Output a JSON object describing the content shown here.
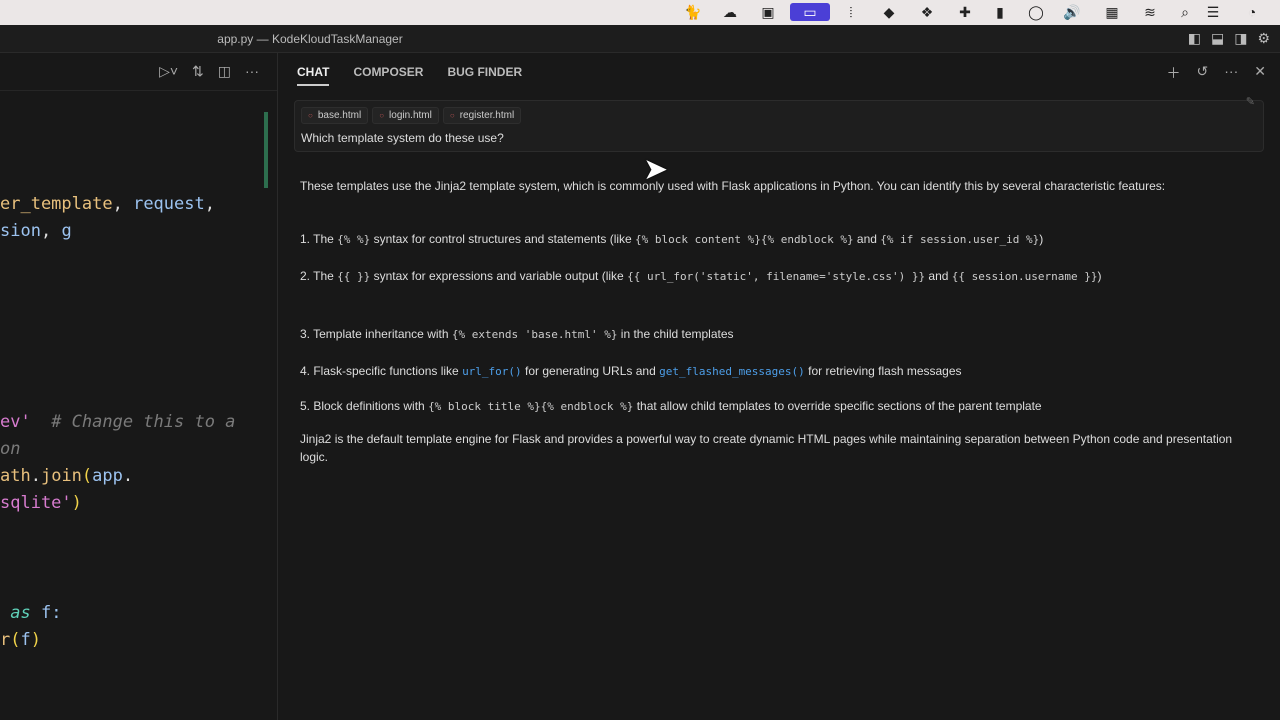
{
  "window": {
    "title": "app.py — KodeKloudTaskManager"
  },
  "menubar": {
    "icons": [
      "cat-icon",
      "cloud-icon",
      "script-icon",
      "screen-share-icon",
      "audio-icon",
      "evernote-icon",
      "dropbox-icon",
      "plugin-icon",
      "film-icon",
      "circle-icon",
      "volume-icon",
      "grid-icon",
      "wifi-icon",
      "search-icon",
      "control-center-icon",
      "clock-icon"
    ]
  },
  "editor": {
    "lines": [
      [
        {
          "t": "er_template",
          "c": "k"
        },
        {
          "t": ", ",
          "c": "w"
        },
        {
          "t": "request",
          "c": "b"
        },
        {
          "t": ",",
          "c": "w"
        }
      ],
      [
        {
          "t": "sion",
          "c": "b"
        },
        {
          "t": ", ",
          "c": "w"
        },
        {
          "t": "g",
          "c": "b"
        }
      ],
      [
        {
          "t": "ev'",
          "c": "p"
        },
        {
          "t": "  # Change this to a",
          "c": "c"
        }
      ],
      [
        {
          "t": "on",
          "c": "c"
        }
      ],
      [
        {
          "t": "ath",
          "c": "k"
        },
        {
          "t": ".",
          "c": "w"
        },
        {
          "t": "join",
          "c": "k"
        },
        {
          "t": "(",
          "c": "y"
        },
        {
          "t": "app",
          "c": "b"
        },
        {
          "t": ".",
          "c": "w"
        }
      ],
      [
        {
          "t": "sqlite'",
          "c": "p"
        },
        {
          "t": ")",
          "c": "y"
        }
      ],
      [
        {
          "t": " as",
          "c": "t"
        },
        {
          "t": " f:",
          "c": "b"
        }
      ],
      [
        {
          "t": "r",
          "c": "k"
        },
        {
          "t": "(",
          "c": "y"
        },
        {
          "t": "f",
          "c": "b"
        },
        {
          "t": ")",
          "c": "y"
        }
      ]
    ]
  },
  "chat": {
    "tabs": [
      "CHAT",
      "COMPOSER",
      "BUG FINDER"
    ],
    "chips": [
      "base.html",
      "login.html",
      "register.html"
    ],
    "question": "Which template system do these use?",
    "intro": "These templates use the Jinja2 template system, which is commonly used with Flask applications in Python. You can identify this by several characteristic features:",
    "p1": [
      "1. The ",
      "{% %}",
      " syntax for control structures and statements (like ",
      "{% block content %}{% endblock %}",
      " and ",
      "{% if session.user_id %}",
      ")"
    ],
    "p2": [
      "2. The ",
      "{{ }}",
      " syntax for expressions and variable output (like ",
      "{{ url_for('static', filename='style.css') }}",
      " and ",
      "{{ session.username }}",
      ")"
    ],
    "p3": [
      "3. Template inheritance with ",
      "{% extends 'base.html' %}",
      " in the child templates"
    ],
    "p4": [
      "4. Flask-specific functions like ",
      "url_for()",
      " for generating URLs and ",
      "get_flashed_messages()",
      " for retrieving flash messages"
    ],
    "p5": [
      "5. Block definitions with ",
      "{% block title %}{% endblock %}",
      " that allow child templates to override specific sections of the parent template"
    ],
    "outro": "Jinja2 is the default template engine for Flask and provides a powerful way to create dynamic HTML pages while maintaining separation between Python code and presentation logic."
  }
}
